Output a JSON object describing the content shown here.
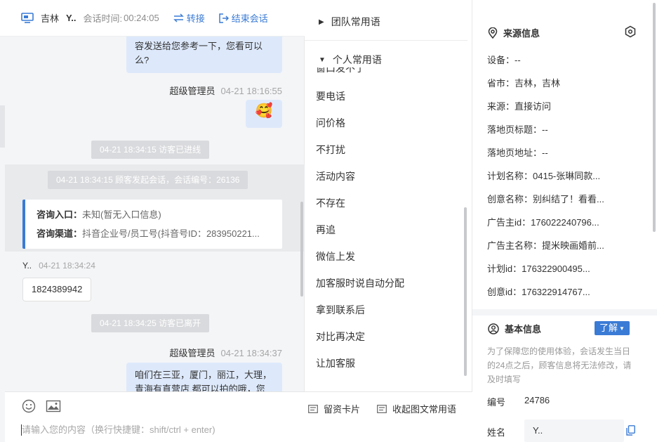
{
  "header": {
    "location": "吉林",
    "visitor": "Y..",
    "duration_label": "会话时间:",
    "duration": "00:24:05",
    "transfer_label": "转接",
    "end_label": "结束会话"
  },
  "chat": {
    "top_bubble_text": "容发送给您参考一下，您看可以么?",
    "agent_name": "超级管理员",
    "agent_time_1": "04-21 18:16:55",
    "emoji": "🥰",
    "sys_visitor_in": "04-21 18:34:15 访客已进线",
    "sys_session_start": "04-21 18:34:15 顾客发起会话，会话编号：26136",
    "card": {
      "entry_label": "咨询入口：",
      "entry_value": "未知(暂无入口信息)",
      "channel_label": "咨询渠道：",
      "channel_value": "抖音企业号/员工号(抖音号ID：283950221..."
    },
    "visitor_name": "Y..",
    "visitor_time": "04-21 18:34:24",
    "visitor_message": "1824389942",
    "sys_visitor_left": "04-21 18:34:25 访客已离开",
    "agent_time_2": "04-21 18:34:37",
    "bottom_bubble_text": "咱们在三亚，厦门，丽江，大理，青海有直营店 都可以拍的哦，您"
  },
  "composer": {
    "leave_card_label": "留资卡片",
    "collapse_label": "收起图文常用语",
    "placeholder": "请输入您的内容（换行快捷键：shift/ctrl + enter)"
  },
  "phrases": {
    "team_label": "团队常用语",
    "personal_label": "个人常用语",
    "partial_item": "窗口发不了",
    "items": [
      "要电话",
      "问价格",
      "不打扰",
      "活动内容",
      "不存在",
      "再追",
      "微信上发",
      "加客服时说自动分配",
      "拿到联系后",
      "对比再决定",
      "让加客服"
    ]
  },
  "info": {
    "source_title": "来源信息",
    "rows": [
      "设备：--",
      "省市：吉林，吉林",
      "来源：直接访问",
      "落地页标题：--",
      "落地页地址：--",
      "计划名称：0415-张琳同款...",
      "创意名称：别纠结了！看看...",
      "广告主id：176022240796...",
      "广告主名称：提米映画婚前...",
      "计划id：176322900495...",
      "创意id：176322914767..."
    ],
    "basic_title": "基本信息",
    "learn_label": "了解",
    "notice": "为了保障您的使用体验，会话发生当日的24点之后，顾客信息将无法修改，请及时填写",
    "id_label": "编号",
    "id_value": "24786",
    "name_label": "姓名",
    "name_value": "Y.."
  },
  "colors": {
    "accent": "#3a7bd5",
    "bubble_out": "#dde9fb",
    "system_pill": "#d9dadd"
  }
}
